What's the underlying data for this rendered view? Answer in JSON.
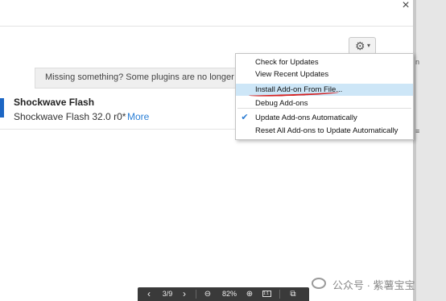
{
  "window": {
    "close_glyph": "×"
  },
  "toolbar": {
    "gear_icon": "⚙",
    "caret_icon": "▾"
  },
  "notice": {
    "text": "Missing something? Some plugins are no longer supporte"
  },
  "plugin": {
    "name": "Shockwave Flash",
    "version": "Shockwave Flash 32.0 r0*",
    "more_link": "More"
  },
  "menu": {
    "items": [
      {
        "label": "Check for Updates"
      },
      {
        "label": "View Recent Updates"
      },
      {
        "label": "Install Add-on From File..."
      },
      {
        "label": "Debug Add-ons"
      },
      {
        "label": "Update Add-ons Automatically"
      },
      {
        "label": "Reset All Add-ons to Update Automatically"
      }
    ],
    "highlighted_index": 2,
    "checked_index": 4,
    "check_glyph": "✔"
  },
  "viewer": {
    "prev": "‹",
    "page": "3/9",
    "next": "›",
    "zoom_out": "⊖",
    "zoom": "82%",
    "zoom_in": "⊕",
    "fit": "1:1",
    "copy": "⧉"
  },
  "watermark": {
    "text": "公众号 · 紫薯宝宝"
  },
  "colors": {
    "accent": "#2a7fd6",
    "highlight": "#cde6f7",
    "annotation": "#d42020"
  }
}
